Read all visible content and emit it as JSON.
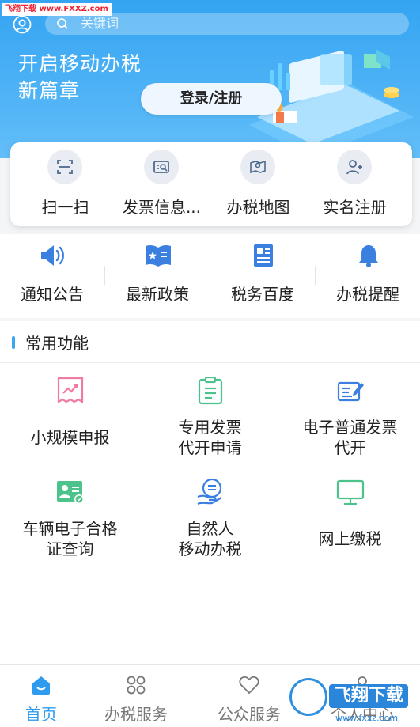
{
  "watermark": {
    "top": "飞翔下载 www.FXXZ.com",
    "brand": "飞翔下载",
    "url": "www.fxxz.com"
  },
  "header": {
    "search_placeholder": "关键词",
    "slogan_line1": "开启移动办税",
    "slogan_line2": "新篇章",
    "login_label": "登录/注册"
  },
  "quick_actions": [
    {
      "label": "扫一扫",
      "icon": "scan-icon"
    },
    {
      "label": "发票信息...",
      "icon": "invoice-search-icon"
    },
    {
      "label": "办税地图",
      "icon": "map-pin-icon"
    },
    {
      "label": "实名注册",
      "icon": "add-user-icon"
    }
  ],
  "notices": [
    {
      "label": "通知公告",
      "icon": "speaker-icon"
    },
    {
      "label": "最新政策",
      "icon": "book-star-icon"
    },
    {
      "label": "税务百度",
      "icon": "newspaper-icon"
    },
    {
      "label": "办税提醒",
      "icon": "bell-icon"
    }
  ],
  "common": {
    "title": "常用功能",
    "items": [
      {
        "line1": "小规模申报",
        "line2": "",
        "icon": "chart-receipt-icon"
      },
      {
        "line1": "专用发票",
        "line2": "代开申请",
        "icon": "clipboard-icon"
      },
      {
        "line1": "电子普通发票",
        "line2": "代开",
        "icon": "invoice-edit-icon"
      },
      {
        "line1": "车辆电子合格",
        "line2": "证查询",
        "icon": "certificate-icon"
      },
      {
        "line1": "自然人",
        "line2": "移动办税",
        "icon": "hand-coin-icon"
      },
      {
        "line1": "网上缴税",
        "line2": "",
        "icon": "monitor-icon"
      }
    ]
  },
  "tabs": [
    {
      "label": "首页",
      "icon": "home-icon",
      "active": true
    },
    {
      "label": "办税服务",
      "icon": "grid-icon",
      "active": false
    },
    {
      "label": "公众服务",
      "icon": "heart-icon",
      "active": false
    },
    {
      "label": "个人中心",
      "icon": "person-icon",
      "active": false
    }
  ],
  "colors": {
    "accent": "#2f9bee",
    "hero": "#4fb3f6",
    "pink": "#f07aa0",
    "green": "#4cc38a",
    "blue": "#3b7fe0"
  }
}
